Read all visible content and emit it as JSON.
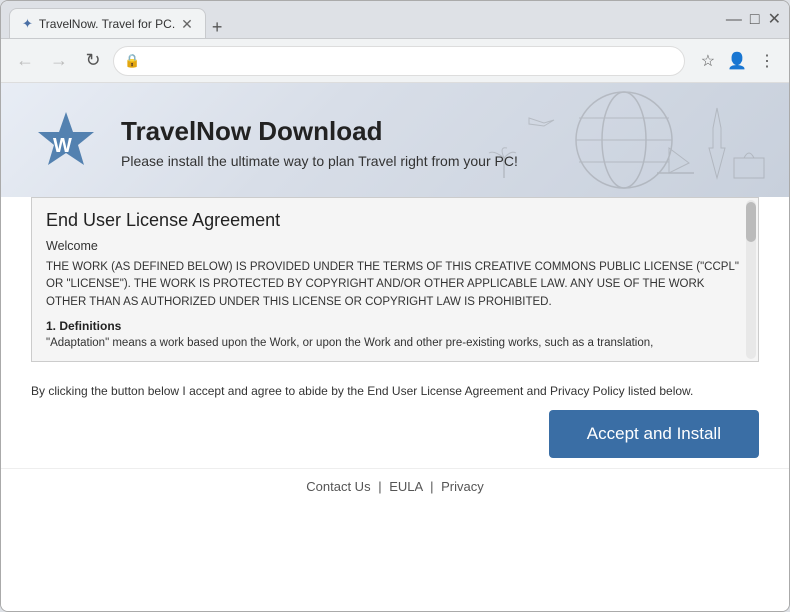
{
  "browser": {
    "tab_title": "TravelNow. Travel for PC.",
    "new_tab_icon": "+",
    "minimize_icon": "—",
    "maximize_icon": "□",
    "close_icon": "✕",
    "back_disabled": true,
    "forward_disabled": true,
    "refresh_icon": "↻",
    "lock_icon": "🔒",
    "address": "",
    "bookmark_icon": "☆",
    "profile_icon": "👤",
    "menu_icon": "⋮"
  },
  "hero": {
    "title": "TravelNow Download",
    "subtitle": "Please install the ultimate way to plan Travel right from your PC!"
  },
  "eula": {
    "title": "End User License Agreement",
    "welcome": "Welcome",
    "body": "THE WORK (AS DEFINED BELOW) IS PROVIDED UNDER THE TERMS OF THIS CREATIVE COMMONS PUBLIC LICENSE (\"CCPL\" OR \"LICENSE\"). THE WORK IS PROTECTED BY COPYRIGHT AND/OR OTHER APPLICABLE LAW. ANY USE OF THE WORK OTHER THAN AS AUTHORIZED UNDER THIS LICENSE OR COPYRIGHT LAW IS PROHIBITED.",
    "section1_title": "1. Definitions",
    "definition": "\"Adaptation\" means a work based upon the Work, or upon the Work and other pre-existing works, such as a translation,"
  },
  "accept": {
    "note": "By clicking the button below I accept and agree to abide by the End User License Agreement and Privacy Policy listed below.",
    "button_label": "Accept and Install"
  },
  "footer": {
    "contact_label": "Contact Us",
    "eula_label": "EULA",
    "privacy_label": "Privacy",
    "sep": "|"
  }
}
